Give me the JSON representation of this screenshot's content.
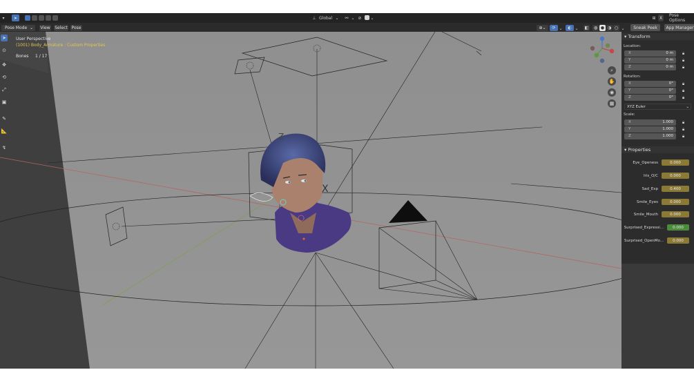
{
  "header": {
    "orientation": "Global",
    "options_button": "Pose Options",
    "mode": "Pose Mode",
    "menus": [
      "View",
      "Select",
      "Pose"
    ],
    "sneak_peek": "Sneak Peek",
    "app_manager": "App Manager"
  },
  "viewport": {
    "perspective": "User Perspective",
    "object_info": "(1001) Body_Armature : Custom Properties",
    "bones_label": "Bones",
    "bones_value": "1 / 17",
    "axis_label_z": "Z",
    "axis_label_x": "X"
  },
  "transform": {
    "title": "Transform",
    "location_label": "Location:",
    "location": [
      {
        "axis": "X",
        "value": "0 m"
      },
      {
        "axis": "Y",
        "value": "0 m"
      },
      {
        "axis": "Z",
        "value": "0 m"
      }
    ],
    "rotation_label": "Rotation:",
    "rotation": [
      {
        "axis": "X",
        "value": "0°"
      },
      {
        "axis": "Y",
        "value": "0°"
      },
      {
        "axis": "Z",
        "value": "0°"
      }
    ],
    "rotation_mode": "XYZ Euler",
    "scale_label": "Scale:",
    "scale": [
      {
        "axis": "X",
        "value": "1.000"
      },
      {
        "axis": "Y",
        "value": "1.000"
      },
      {
        "axis": "Z",
        "value": "1.000"
      }
    ]
  },
  "properties": {
    "title": "Properties",
    "items": [
      {
        "name": "Eye_Openess",
        "value": "0.000"
      },
      {
        "name": "Iris_O/C",
        "value": "0.000"
      },
      {
        "name": "Sad_Exp",
        "value": "0.400"
      },
      {
        "name": "Smile_Eyes",
        "value": "0.000"
      },
      {
        "name": "Smile_Mouth",
        "value": "0.000"
      },
      {
        "name": "Surprised_Expressi...",
        "value": "0.000"
      },
      {
        "name": "Surprised_OpenMo...",
        "value": "0.000"
      }
    ]
  },
  "colors": {
    "accent": "#4772b3",
    "property_slider": "#8a7a35",
    "property_slider_green": "#4c8a3c",
    "object_info": "#e3c64a"
  },
  "icons": [
    "select-box-icon",
    "cursor-icon",
    "move-icon",
    "rotate-icon",
    "scale-icon",
    "transform-icon",
    "annotate-icon",
    "measure-icon",
    "zoom-icon",
    "hand-icon",
    "camera-icon",
    "grid-icon",
    "lock-icon"
  ]
}
